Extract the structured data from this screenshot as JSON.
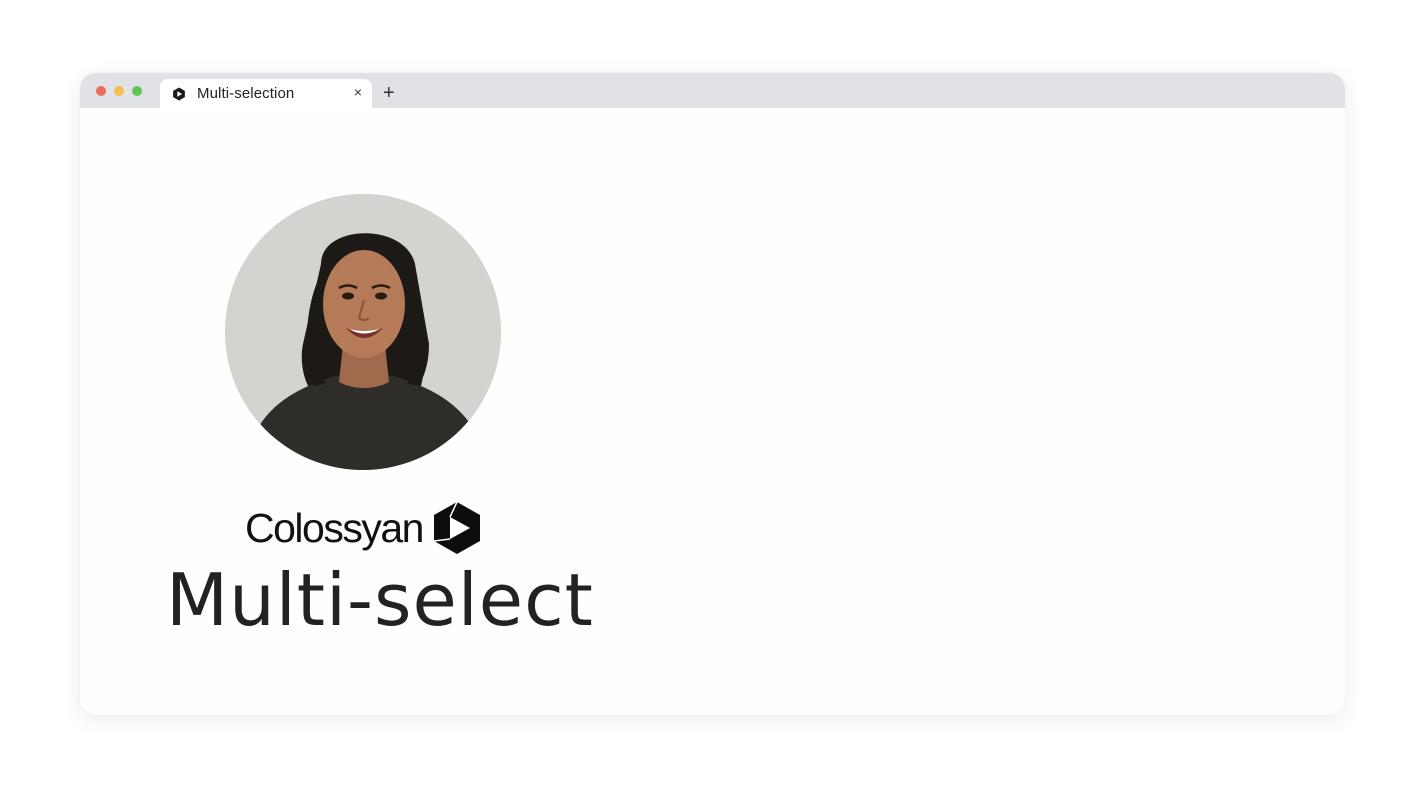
{
  "window": {
    "controls": {
      "close_color": "#ed6a5e",
      "minimize_color": "#f4bf4f",
      "maximize_color": "#61c554"
    },
    "tab": {
      "title": "Multi-selection",
      "icon": "colossyan-logo-icon",
      "close_label": "×"
    },
    "new_tab_label": "+"
  },
  "content": {
    "avatar": "presenter-avatar",
    "brand": {
      "name": "Colossyan",
      "logo": "colossyan-logo-icon"
    },
    "headline": "Multi-select"
  }
}
